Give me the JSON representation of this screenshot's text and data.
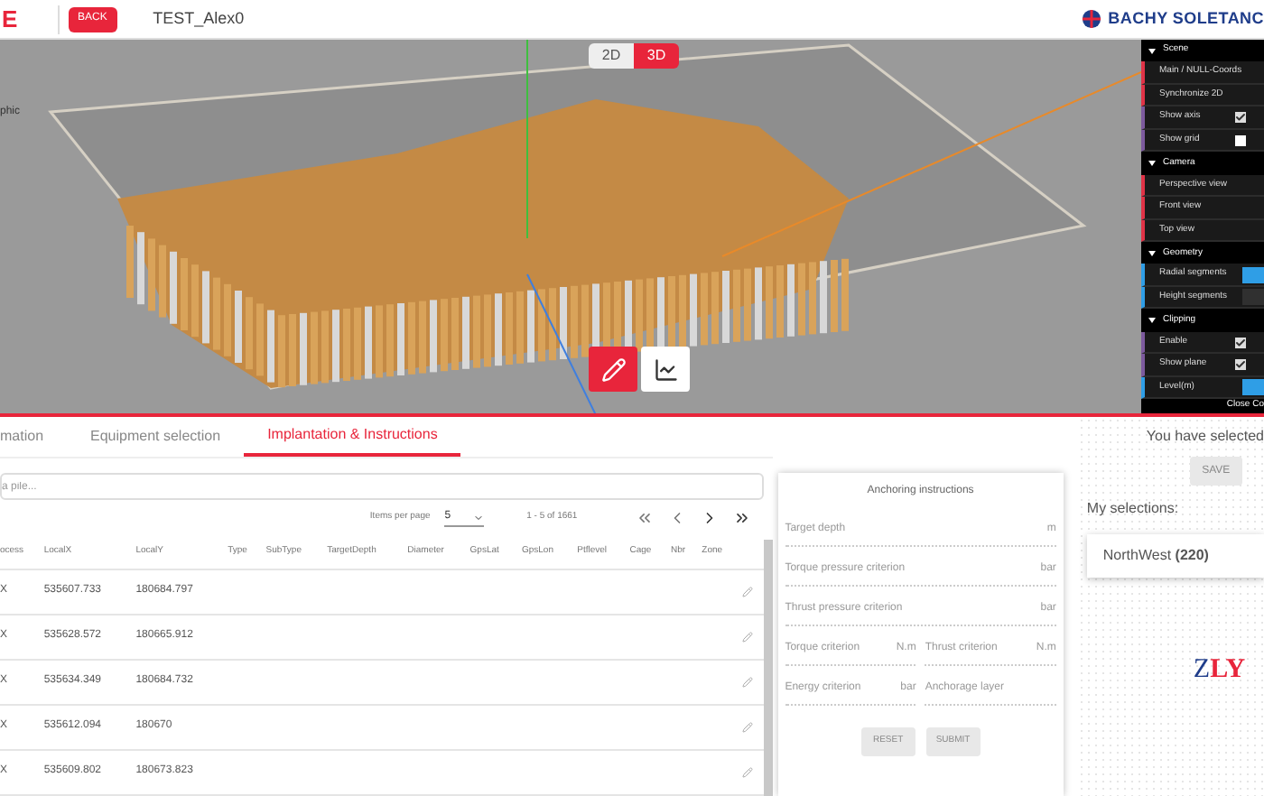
{
  "header": {
    "logo_letter": "E",
    "back_button": "BACK",
    "project_title": "TEST_Alex0",
    "brand": "BACHY SOLETANC"
  },
  "viewport": {
    "camera_label": "phic",
    "view_modes": [
      {
        "label": "2D",
        "selected": false
      },
      {
        "label": "3D",
        "selected": true
      }
    ],
    "tools": [
      {
        "kind": "edit",
        "selected": true
      },
      {
        "kind": "chart",
        "selected": false
      }
    ]
  },
  "controls": {
    "items": [
      {
        "kind": "section",
        "label": "Scene"
      },
      {
        "kind": "button",
        "label": "Main / NULL-Coords"
      },
      {
        "kind": "button",
        "label": "Synchronize 2D"
      },
      {
        "kind": "checkbox",
        "label": "Show axis",
        "checked": true
      },
      {
        "kind": "checkbox",
        "label": "Show grid",
        "checked": false
      },
      {
        "kind": "section",
        "label": "Camera"
      },
      {
        "kind": "button",
        "label": "Perspective view"
      },
      {
        "kind": "button",
        "label": "Front view"
      },
      {
        "kind": "button",
        "label": "Top view"
      },
      {
        "kind": "section",
        "label": "Geometry"
      },
      {
        "kind": "slider",
        "label": "Radial segments",
        "level": 1
      },
      {
        "kind": "slider",
        "label": "Height segments",
        "level": 0
      },
      {
        "kind": "section",
        "label": "Clipping"
      },
      {
        "kind": "checkbox",
        "label": "Enable",
        "checked": true
      },
      {
        "kind": "checkbox",
        "label": "Show plane",
        "checked": true
      },
      {
        "kind": "slider",
        "label": "Level(m)",
        "level": 1
      }
    ],
    "close_button": "Close Co"
  },
  "tabs": [
    {
      "label": "mation",
      "selected": false
    },
    {
      "label": "Equipment selection",
      "selected": false
    },
    {
      "label": "Implantation & Instructions",
      "selected": true
    }
  ],
  "search": {
    "placeholder": "a pile..."
  },
  "pagination": {
    "label": "Items per page",
    "per_page": "5",
    "range": "1 - 5 of 1661"
  },
  "table": {
    "columns": [
      "ocess",
      "LocalX",
      "LocalY",
      "Type",
      "SubType",
      "TargetDepth",
      "Diameter",
      "GpsLat",
      "GpsLon",
      "Ptflevel",
      "Cage",
      "Nbr",
      "Zone"
    ],
    "rows": [
      [
        "X",
        "535607.733",
        "180684.797"
      ],
      [
        "X",
        "535628.572",
        "180665.912"
      ],
      [
        "X",
        "535634.349",
        "180684.732"
      ],
      [
        "X",
        "535612.094",
        "180670"
      ],
      [
        "X",
        "535609.802",
        "180673.823"
      ]
    ]
  },
  "anchoring": {
    "title": "Anchoring instructions",
    "fields": [
      [
        {
          "label": "Target depth",
          "unit": "m"
        }
      ],
      [
        {
          "label": "Torque pressure criterion",
          "unit": "bar"
        }
      ],
      [
        {
          "label": "Thrust pressure criterion",
          "unit": "bar"
        }
      ],
      [
        {
          "label": "Torque criterion",
          "unit": "N.m"
        },
        {
          "label": "Thrust criterion",
          "unit": "N.m"
        }
      ],
      [
        {
          "label": "Energy criterion",
          "unit": "bar"
        },
        {
          "label": "Anchorage layer"
        }
      ]
    ],
    "buttons": [
      {
        "label": "RESET",
        "disabled": true
      },
      {
        "label": "SUBMIT",
        "disabled": true
      }
    ]
  },
  "selection": {
    "summary": "You have selected",
    "save_button": {
      "label": "SAVE",
      "disabled": true
    },
    "heading": "My selections:",
    "items": [
      {
        "name": "NorthWest",
        "count": "(220)"
      }
    ]
  },
  "footer_logo": {
    "letters_left": "Z",
    "letters_right": "LY"
  }
}
